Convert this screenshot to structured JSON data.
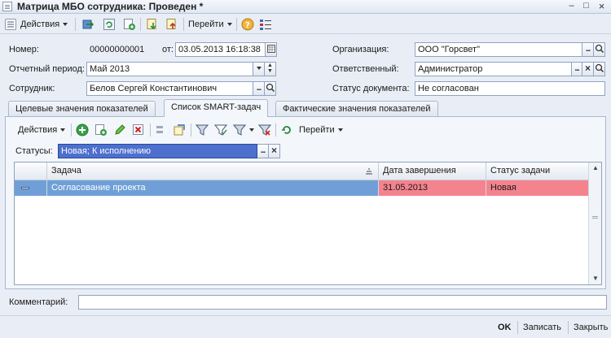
{
  "window": {
    "title": "Матрица МБО сотрудника: Проведен *",
    "buttons": {
      "minimize": "–",
      "maximize": "□",
      "close": "×"
    }
  },
  "toolbar": {
    "actions_label": "Действия",
    "goto_label": "Перейти",
    "icons": [
      "list-icon",
      "save-post-icon",
      "refresh-icon",
      "copy-icon",
      "move-down-icon",
      "move-up-icon",
      "help-icon",
      "structure-icon"
    ]
  },
  "form": {
    "number_label": "Номер:",
    "number_value": "00000000001",
    "date_label": "от:",
    "date_value": "03.05.2013 16:18:38",
    "period_label": "Отчетный период:",
    "period_value": "Май 2013",
    "employee_label": "Сотрудник:",
    "employee_value": "Белов Сергей Константинович",
    "organization_label": "Организация:",
    "organization_value": "ООО \"Горсвет\"",
    "responsible_label": "Ответственный:",
    "responsible_value": "Администратор",
    "doc_status_label": "Статус документа:",
    "doc_status_value": "Не согласован"
  },
  "tabs": [
    {
      "label": "Целевые значения показателей",
      "active": false
    },
    {
      "label": "Список SMART-задач",
      "active": true
    },
    {
      "label": "Фактические значения показателей",
      "active": false
    }
  ],
  "panel": {
    "actions_label": "Действия",
    "goto_label": "Перейти",
    "statuses_label": "Статусы:",
    "statuses_value": "Новая; К исполнению"
  },
  "table": {
    "columns": [
      "Задача",
      "Дата завершения",
      "Статус задачи"
    ],
    "rows": [
      {
        "task": "Согласование проекта",
        "due": "31.05.2013",
        "status": "Новая"
      }
    ]
  },
  "comment_label": "Комментарий:",
  "comment_value": "",
  "bottom": {
    "ok": "OK",
    "write": "Записать",
    "close": "Закрыть"
  },
  "colors": {
    "selected_row": "#6f9fd6",
    "overdue_cell": "#f4838e",
    "statuses_field": "#4d6fce"
  }
}
